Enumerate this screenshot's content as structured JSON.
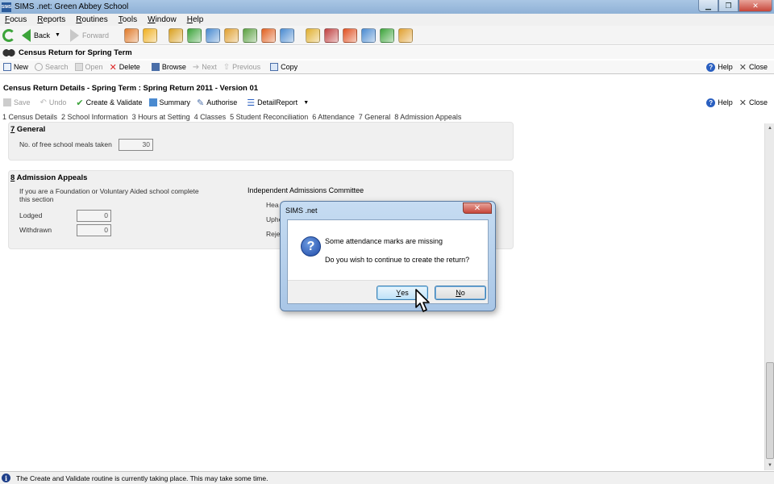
{
  "window": {
    "title": "SIMS .net: Green Abbey School",
    "app_icon": "SIMS"
  },
  "menu": [
    {
      "label": "Focus",
      "u": "F",
      "rest": "ocus"
    },
    {
      "label": "Reports",
      "u": "R",
      "rest": "eports"
    },
    {
      "label": "Routines",
      "u": "R",
      "rest": "outines"
    },
    {
      "label": "Tools",
      "u": "T",
      "rest": "ools"
    },
    {
      "label": "Window",
      "u": "W",
      "rest": "indow"
    },
    {
      "label": "Help",
      "u": "H",
      "rest": "elp"
    }
  ],
  "nav": {
    "back": "Back",
    "forward": "Forward"
  },
  "toolbar_icon_colors": [
    "#e07a2a",
    "#f0b020",
    "#d9a020",
    "#3ca33a",
    "#4a8ad0",
    "#e0a030",
    "#5aa040",
    "#e06020",
    "#4a8ad0",
    "#e0b030",
    "#c04040",
    "#e05020",
    "#4a8ad0",
    "#3ca33a",
    "#e0a030"
  ],
  "census": {
    "title": "Census Return for Spring Term",
    "new": "New",
    "search": "Search",
    "open": "Open",
    "delete": "Delete",
    "browse": "Browse",
    "next": "Next",
    "previous": "Previous",
    "copy": "Copy",
    "help": "Help",
    "close": "Close"
  },
  "details": {
    "title": "Census Return Details - Spring Term : Spring Return 2011 - Version 01",
    "save": "Save",
    "undo": "Undo",
    "create_validate": "Create & Validate",
    "summary": "Summary",
    "authorise": "Authorise",
    "detail_report": "DetailReport",
    "help": "Help",
    "close": "Close"
  },
  "sections": [
    "1 Census Details",
    "2 School Information",
    "3 Hours at Setting",
    "4 Classes",
    "5 Student Reconciliation",
    "6 Attendance",
    "7 General",
    "8 Admission Appeals"
  ],
  "general": {
    "num": "7",
    "heading": " General",
    "meals_label": "No. of free school meals taken",
    "meals_value": "30"
  },
  "appeals": {
    "num": "8",
    "heading": " Admission Appeals",
    "note": "If you are a Foundation or Voluntary Aided school complete this section",
    "lodged_label": "Lodged",
    "lodged_value": "0",
    "withdrawn_label": "Withdrawn",
    "withdrawn_value": "0",
    "committee": "Independent Admissions Committee",
    "heard_label": "Hea",
    "upheld_label": "Uphe",
    "rejected_label": "Reje"
  },
  "dialog": {
    "title": "SIMS .net",
    "close": "✕",
    "message1": "Some attendance marks are missing",
    "message2": "Do you wish to continue to create the return?",
    "yes_u": "Y",
    "yes_rest": "es",
    "no_u": "N",
    "no_rest": "o"
  },
  "status": {
    "text": "The Create and Validate routine is currently taking place. This may take some time."
  }
}
